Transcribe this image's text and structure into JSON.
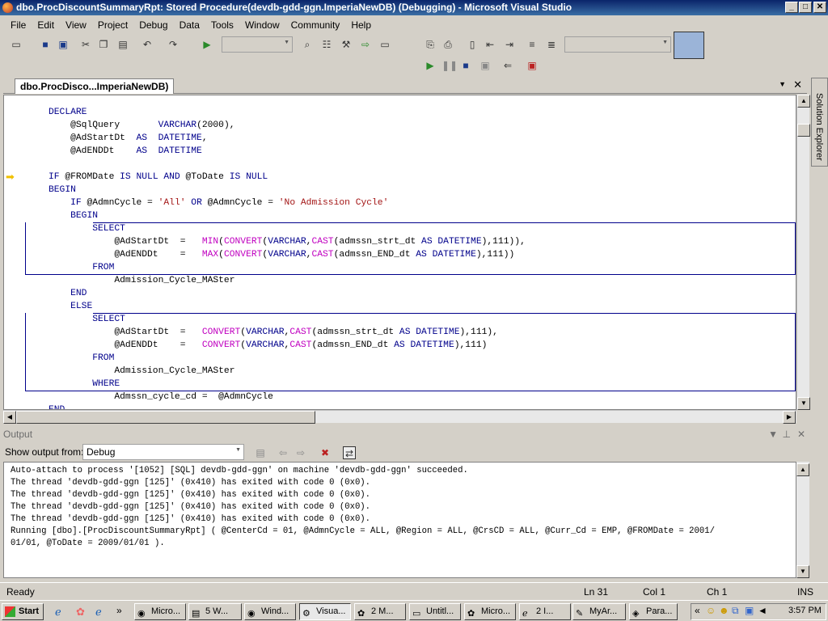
{
  "window": {
    "title": "dbo.ProcDiscountSummaryRpt: Stored Procedure(devdb-gdd-ggn.ImperiaNewDB) (Debugging) - Microsoft Visual Studio",
    "min": "_",
    "max": "□",
    "close": "✕"
  },
  "menu": [
    "File",
    "Edit",
    "View",
    "Project",
    "Debug",
    "Data",
    "Tools",
    "Window",
    "Community",
    "Help"
  ],
  "doc_tab": {
    "label": "dbo.ProcDisco...ImperiaNewDB)"
  },
  "side_panel": {
    "label": "Solution Explorer"
  },
  "code_lines": [
    [
      [
        "DECLARE",
        "kw"
      ]
    ],
    [
      [
        "    @SqlQuery       ",
        ""
      ],
      [
        "VARCHAR",
        "kw"
      ],
      [
        "(2000),",
        ""
      ]
    ],
    [
      [
        "    @AdStartDt  ",
        ""
      ],
      [
        "AS",
        "kw"
      ],
      [
        "  ",
        ""
      ],
      [
        "DATETIME",
        "kw"
      ],
      [
        ",",
        ""
      ]
    ],
    [
      [
        "    @AdENDDt    ",
        ""
      ],
      [
        "AS",
        "kw"
      ],
      [
        "  ",
        ""
      ],
      [
        "DATETIME",
        "kw"
      ]
    ],
    [
      [
        "",
        ""
      ]
    ],
    [
      [
        "IF",
        "kw"
      ],
      [
        " @FROMDate ",
        ""
      ],
      [
        "IS NULL AND",
        "kw"
      ],
      [
        " @ToDate ",
        ""
      ],
      [
        "IS NULL",
        "kw"
      ]
    ],
    [
      [
        "BEGIN",
        "kw"
      ]
    ],
    [
      [
        "    IF",
        "kw"
      ],
      [
        " @AdmnCycle = ",
        ""
      ],
      [
        "'All'",
        "str"
      ],
      [
        " ",
        ""
      ],
      [
        "OR",
        "kw"
      ],
      [
        " @AdmnCycle = ",
        ""
      ],
      [
        "'No Admission Cycle'",
        "str"
      ]
    ],
    [
      [
        "    BEGIN",
        "kw"
      ]
    ],
    [
      [
        "        SELECT",
        "kw"
      ]
    ],
    [
      [
        "            @AdStartDt  =   ",
        ""
      ],
      [
        "MIN",
        "fn"
      ],
      [
        "(",
        ""
      ],
      [
        "CONVERT",
        "fn"
      ],
      [
        "(",
        ""
      ],
      [
        "VARCHAR",
        "kw"
      ],
      [
        ",",
        ""
      ],
      [
        "CAST",
        "fn"
      ],
      [
        "(admssn_strt_dt ",
        ""
      ],
      [
        "AS DATETIME",
        "kw"
      ],
      [
        "),111)),",
        ""
      ]
    ],
    [
      [
        "            @AdENDDt    =   ",
        ""
      ],
      [
        "MAX",
        "fn"
      ],
      [
        "(",
        ""
      ],
      [
        "CONVERT",
        "fn"
      ],
      [
        "(",
        ""
      ],
      [
        "VARCHAR",
        "kw"
      ],
      [
        ",",
        ""
      ],
      [
        "CAST",
        "fn"
      ],
      [
        "(admssn_END_dt ",
        ""
      ],
      [
        "AS DATETIME",
        "kw"
      ],
      [
        "),111))",
        ""
      ]
    ],
    [
      [
        "        FROM",
        "kw"
      ]
    ],
    [
      [
        "            Admission_Cycle_MASter",
        ""
      ]
    ],
    [
      [
        "    END",
        "kw"
      ]
    ],
    [
      [
        "    ELSE",
        "kw"
      ]
    ],
    [
      [
        "        SELECT",
        "kw"
      ]
    ],
    [
      [
        "            @AdStartDt  =   ",
        ""
      ],
      [
        "CONVERT",
        "fn"
      ],
      [
        "(",
        ""
      ],
      [
        "VARCHAR",
        "kw"
      ],
      [
        ",",
        ""
      ],
      [
        "CAST",
        "fn"
      ],
      [
        "(admssn_strt_dt ",
        ""
      ],
      [
        "AS DATETIME",
        "kw"
      ],
      [
        "),111),",
        ""
      ]
    ],
    [
      [
        "            @AdENDDt    =   ",
        ""
      ],
      [
        "CONVERT",
        "fn"
      ],
      [
        "(",
        ""
      ],
      [
        "VARCHAR",
        "kw"
      ],
      [
        ",",
        ""
      ],
      [
        "CAST",
        "fn"
      ],
      [
        "(admssn_END_dt ",
        ""
      ],
      [
        "AS DATETIME",
        "kw"
      ],
      [
        "),111)",
        ""
      ]
    ],
    [
      [
        "        FROM",
        "kw"
      ]
    ],
    [
      [
        "            Admission_Cycle_MASter",
        ""
      ]
    ],
    [
      [
        "        WHERE",
        "kw"
      ]
    ],
    [
      [
        "            Admssn_cycle_cd =  @AdmnCycle",
        ""
      ]
    ],
    [
      [
        "END",
        "kw"
      ]
    ]
  ],
  "output": {
    "title": "Output",
    "show_from_label": "Show output from:",
    "show_from_value": "Debug",
    "lines": [
      "Auto-attach to process '[1052] [SQL] devdb-gdd-ggn' on machine 'devdb-gdd-ggn' succeeded.",
      "The thread 'devdb-gdd-ggn [125]' (0x410) has exited with code 0 (0x0).",
      "The thread 'devdb-gdd-ggn [125]' (0x410) has exited with code 0 (0x0).",
      "The thread 'devdb-gdd-ggn [125]' (0x410) has exited with code 0 (0x0).",
      "The thread 'devdb-gdd-ggn [125]' (0x410) has exited with code 0 (0x0).",
      "Running [dbo].[ProcDiscountSummaryRpt] ( @CenterCd = 01, @AdmnCycle = ALL, @Region = ALL, @CrsCD = ALL, @Curr_Cd = EMP, @FROMDate = 2001/",
      "01/01, @ToDate = 2009/01/01 )."
    ]
  },
  "status": {
    "ready": "Ready",
    "ln": "Ln 31",
    "col": "Col 1",
    "ch": "Ch 1",
    "ins": "INS"
  },
  "taskbar": {
    "start": "Start",
    "items": [
      "Micro...",
      "5 W...",
      "Wind...",
      "Visua...",
      "2 M...",
      "Untitl...",
      "Micro...",
      "2 I...",
      "MyAr...",
      "Para..."
    ],
    "clock": "3:57 PM"
  }
}
